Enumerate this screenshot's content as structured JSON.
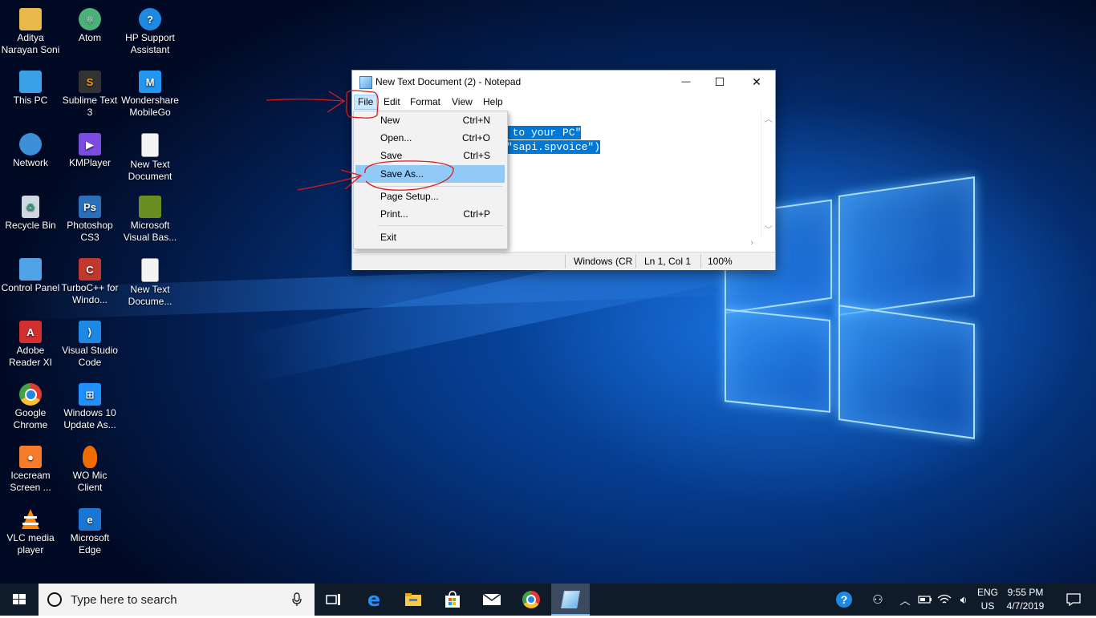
{
  "desktop": {
    "icons": [
      {
        "label": "Aditya Narayan Soni",
        "icon": "user-folder-icon",
        "color": "#e8b84a"
      },
      {
        "label": "Atom",
        "icon": "atom-icon",
        "color": "#4cb07a"
      },
      {
        "label": "HP Support Assistant",
        "icon": "hp-help-icon",
        "color": "#1e88e5"
      },
      {
        "label": "This PC",
        "icon": "computer-icon",
        "color": "#3aa0e8"
      },
      {
        "label": "Sublime Text 3",
        "icon": "sublime-icon",
        "color": "#f59a1b"
      },
      {
        "label": "Wondershare MobileGo",
        "icon": "mobilego-icon",
        "color": "#2196f3"
      },
      {
        "label": "Network",
        "icon": "network-icon",
        "color": "#3d8fd8"
      },
      {
        "label": "KMPlayer",
        "icon": "kmplayer-icon",
        "color": "#7b4ce0"
      },
      {
        "label": "New Text Document",
        "icon": "text-document-icon",
        "color": "#f4f4f4"
      },
      {
        "label": "Recycle Bin",
        "icon": "recycle-bin-icon",
        "color": "#cfd8e0"
      },
      {
        "label": "Photoshop CS3",
        "icon": "photoshop-icon",
        "color": "#2a6fb8"
      },
      {
        "label": "Microsoft Visual Bas...",
        "icon": "visual-basic-icon",
        "color": "#6b8e23"
      },
      {
        "label": "Control Panel",
        "icon": "control-panel-icon",
        "color": "#4fa3e6"
      },
      {
        "label": "TurboC++ for Windo...",
        "icon": "turbo-cpp-icon",
        "color": "#c0392b"
      },
      {
        "label": "New Text Docume...",
        "icon": "text-document-icon",
        "color": "#f4f4f4"
      },
      {
        "label": "Adobe Reader XI",
        "icon": "adobe-reader-icon",
        "color": "#d32f2f"
      },
      {
        "label": "Visual Studio Code",
        "icon": "vscode-icon",
        "color": "#1e88e5"
      },
      {
        "label": "Google Chrome",
        "icon": "chrome-icon",
        "color": "#e53935"
      },
      {
        "label": "Windows 10 Update As...",
        "icon": "windows-update-icon",
        "color": "#1e90ff"
      },
      {
        "label": "Icecream Screen ...",
        "icon": "icecream-icon",
        "color": "#f57c2a"
      },
      {
        "label": "WO Mic Client",
        "icon": "microphone-icon",
        "color": "#ef6c00"
      },
      {
        "label": "VLC media player",
        "icon": "vlc-icon",
        "color": "#ff8800"
      },
      {
        "label": "Microsoft Edge",
        "icon": "edge-icon",
        "color": "#1976d2"
      }
    ]
  },
  "notepad": {
    "title": "New Text Document (2) - Notepad",
    "caption": {
      "minimize": "—",
      "maximize": "☐",
      "close": "✕"
    },
    "menus": [
      "File",
      "Edit",
      "Format",
      "View",
      "Help"
    ],
    "editor_lines": [
      "e to your PC\"",
      "\"sapi.spvoice\")"
    ],
    "status": {
      "encoding": "Windows (CRL",
      "position": "Ln 1, Col 1",
      "zoom": "100%"
    }
  },
  "file_menu": {
    "items": [
      {
        "label": "New",
        "shortcut": "Ctrl+N"
      },
      {
        "label": "Open...",
        "shortcut": "Ctrl+O"
      },
      {
        "label": "Save",
        "shortcut": "Ctrl+S"
      },
      {
        "label": "Save As...",
        "shortcut": ""
      },
      {
        "label": "Page Setup...",
        "shortcut": ""
      },
      {
        "label": "Print...",
        "shortcut": "Ctrl+P"
      },
      {
        "label": "Exit",
        "shortcut": ""
      }
    ],
    "highlighted": "Save As..."
  },
  "taskbar": {
    "search_placeholder": "Type here to search",
    "language": {
      "line1": "ENG",
      "line2": "US"
    },
    "clock": {
      "time": "9:55 PM",
      "date": "4/7/2019"
    },
    "pinned": [
      "task-view-icon",
      "edge-icon",
      "file-explorer-icon",
      "store-icon",
      "mail-icon",
      "chrome-icon",
      "notepad-icon"
    ],
    "accent": "#76b9ed"
  }
}
